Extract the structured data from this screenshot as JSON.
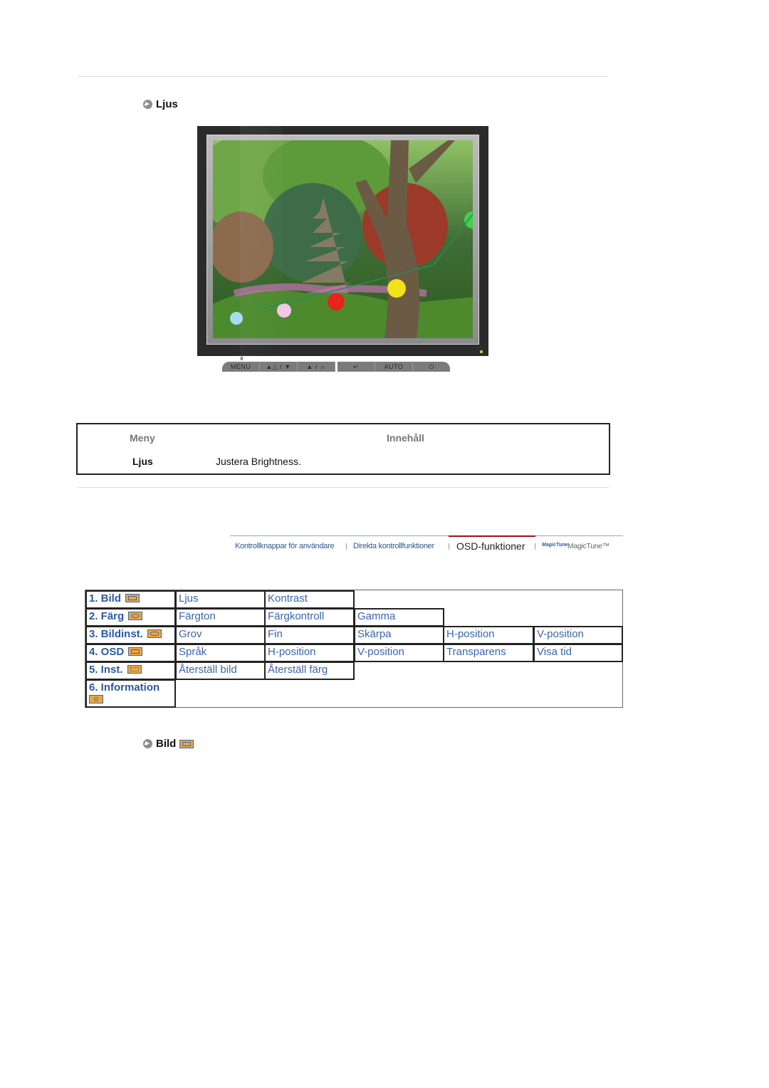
{
  "sections": {
    "top_heading": "Ljus",
    "bottom_heading": "Bild"
  },
  "monitor": {
    "buttons": [
      "MENU",
      "▲△ / ▼",
      "▲ / ☼",
      "↵",
      "AUTO",
      "⏻"
    ],
    "menu_marker": "Ⅲ"
  },
  "info_table": {
    "headers": {
      "menu": "Meny",
      "content": "Innehåll"
    },
    "row": {
      "menu": "Ljus",
      "content": "Justera Brightness."
    }
  },
  "nav": {
    "items": [
      {
        "label": "Kontrollknappar för användare",
        "active": false
      },
      {
        "label": "Direkta kontrollfunktioner",
        "active": false
      },
      {
        "label": "OSD-funktioner",
        "active": true
      },
      {
        "label": "MagicTune™",
        "active": false
      }
    ],
    "magictune_logo": "MagicTune",
    "active_color": "#a0101a",
    "link_color": "#2b5a8c"
  },
  "osd_menu": {
    "rows": [
      {
        "head": "1. Bild",
        "icon": "picture-icon",
        "items": [
          "Ljus",
          "Kontrast"
        ]
      },
      {
        "head": "2. Färg",
        "icon": "color-icon",
        "items": [
          "Färgton",
          "Färgkontroll",
          "Gamma"
        ]
      },
      {
        "head": "3. Bildinst.",
        "icon": "image-setup-icon",
        "items": [
          "Grov",
          "Fin",
          "Skärpa",
          "H-position",
          "V-position"
        ]
      },
      {
        "head": "4. OSD",
        "icon": "osd-icon",
        "items": [
          "Språk",
          "H-position",
          "V-position",
          "Transparens",
          "Visa tid"
        ]
      },
      {
        "head": "5. Inst.",
        "icon": "setup-icon",
        "items": [
          "Återställ bild",
          "Återställ färg"
        ]
      },
      {
        "head": "6. Information",
        "icon": "information-icon",
        "items": []
      }
    ],
    "link_color": "#3b66a8",
    "icon_color": "#f0a640"
  }
}
